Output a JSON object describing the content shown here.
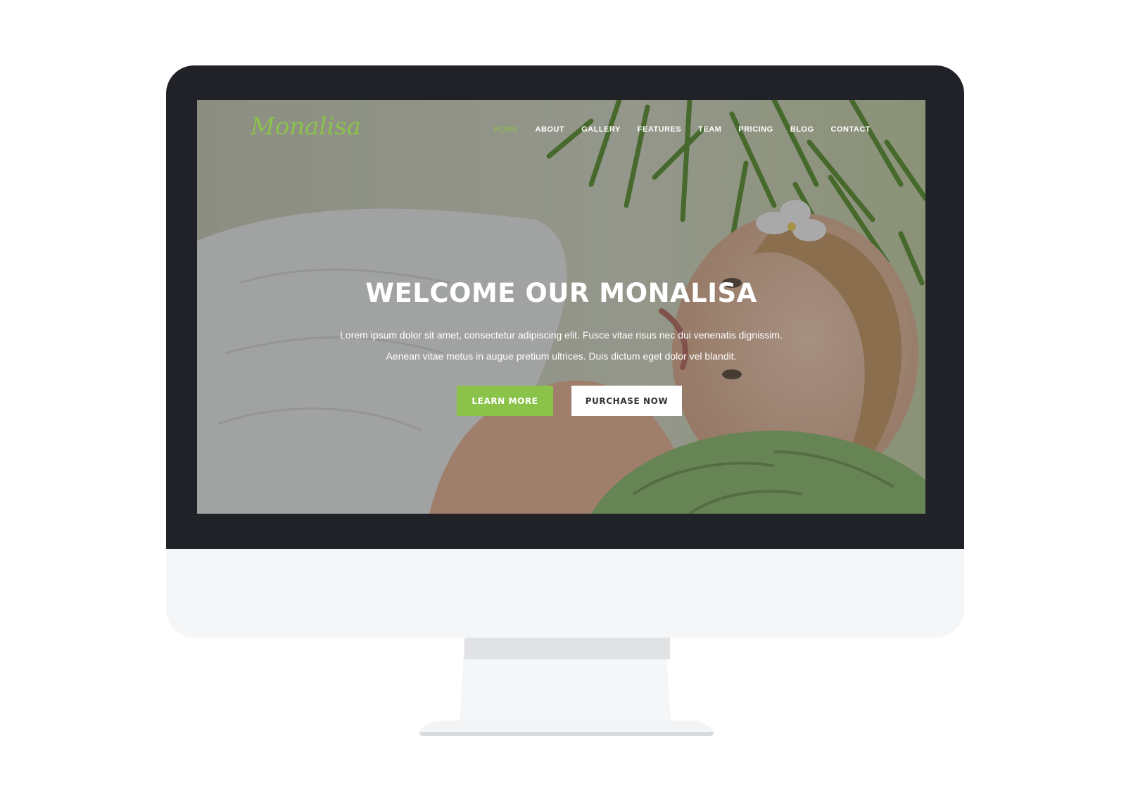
{
  "site": {
    "logo": "Monalisa",
    "nav": [
      {
        "label": "HOME",
        "active": true
      },
      {
        "label": "ABOUT"
      },
      {
        "label": "GALLERY"
      },
      {
        "label": "FEATURES"
      },
      {
        "label": "TEAM"
      },
      {
        "label": "PRICING"
      },
      {
        "label": "BLOG"
      },
      {
        "label": "CONTACT"
      }
    ],
    "hero": {
      "title": "WELCOME OUR MONALISA",
      "text_line1": "Lorem ipsum dolor sit amet, consectetur adipiscing elit. Fusce vitae risus nec dui venenatis dignissim.",
      "text_line2": "Aenean vitae metus in augue pretium ultrices. Duis dictum eget dolor vel blandit.",
      "primary_button": "LEARN MORE",
      "secondary_button": "PURCHASE NOW"
    }
  },
  "colors": {
    "accent": "#8bc34a",
    "bezel": "#212227",
    "chin": "#f5f6f8"
  }
}
